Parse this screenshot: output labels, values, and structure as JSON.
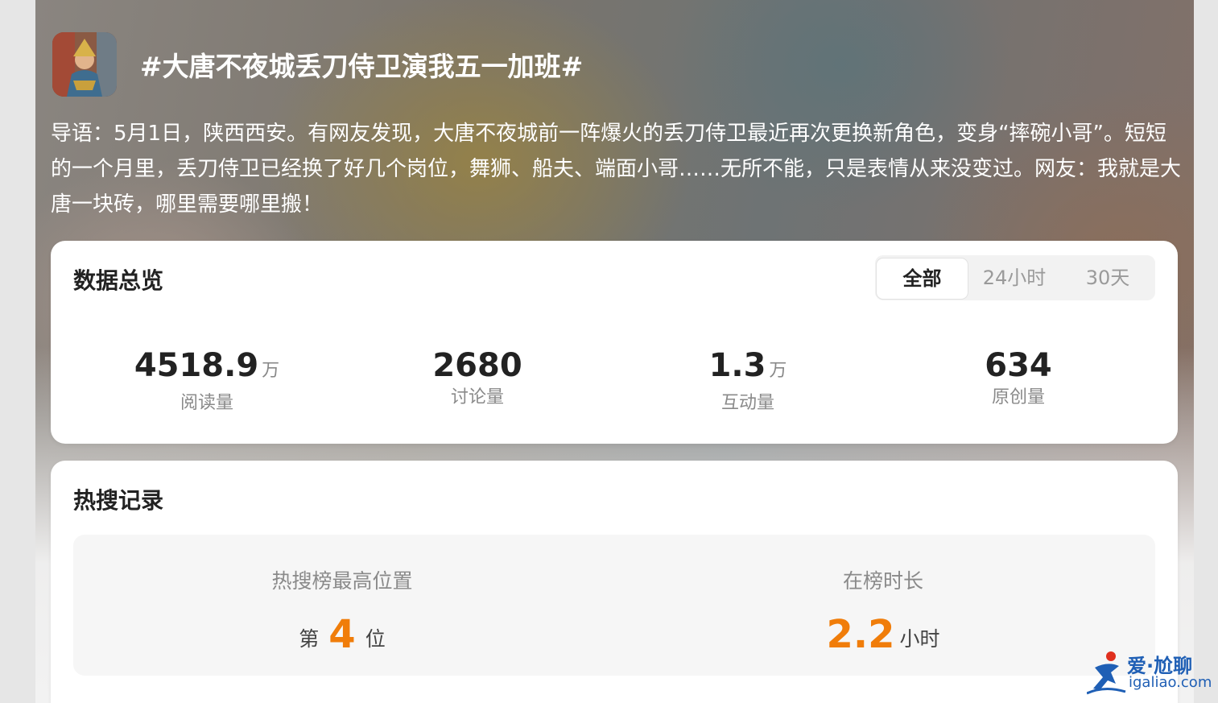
{
  "topic": {
    "title": "#大唐不夜城丢刀侍卫演我五一加班#",
    "intro": "导语：5月1日，陕西西安。有网友发现，大唐不夜城前一阵爆火的丢刀侍卫最近再次更换新角色，变身“摔碗小哥”。短短的一个月里，丢刀侍卫已经换了好几个岗位，舞狮、船夫、端面小哥……无所不能，只是表情从来没变过。网友：我就是大唐一块砖，哪里需要哪里搬！"
  },
  "overview": {
    "title": "数据总览",
    "tabs": [
      "全部",
      "24小时",
      "30天"
    ],
    "active_tab": "全部",
    "stats": [
      {
        "value": "4518.9",
        "unit": "万",
        "label": "阅读量"
      },
      {
        "value": "2680",
        "unit": "",
        "label": "讨论量"
      },
      {
        "value": "1.3",
        "unit": "万",
        "label": "互动量"
      },
      {
        "value": "634",
        "unit": "",
        "label": "原创量"
      }
    ]
  },
  "hot_search": {
    "title": "热搜记录",
    "best_rank": {
      "label": "热搜榜最高位置",
      "prefix": "第",
      "value": "4",
      "suffix": "位"
    },
    "duration": {
      "label": "在榜时长",
      "value": "2.2",
      "suffix": "小时"
    }
  },
  "watermark": {
    "text": "爱·尬聊",
    "url": "igaliao.com"
  },
  "colors": {
    "accent_orange": "#f07d0a",
    "watermark_blue": "#1f5fb5"
  }
}
